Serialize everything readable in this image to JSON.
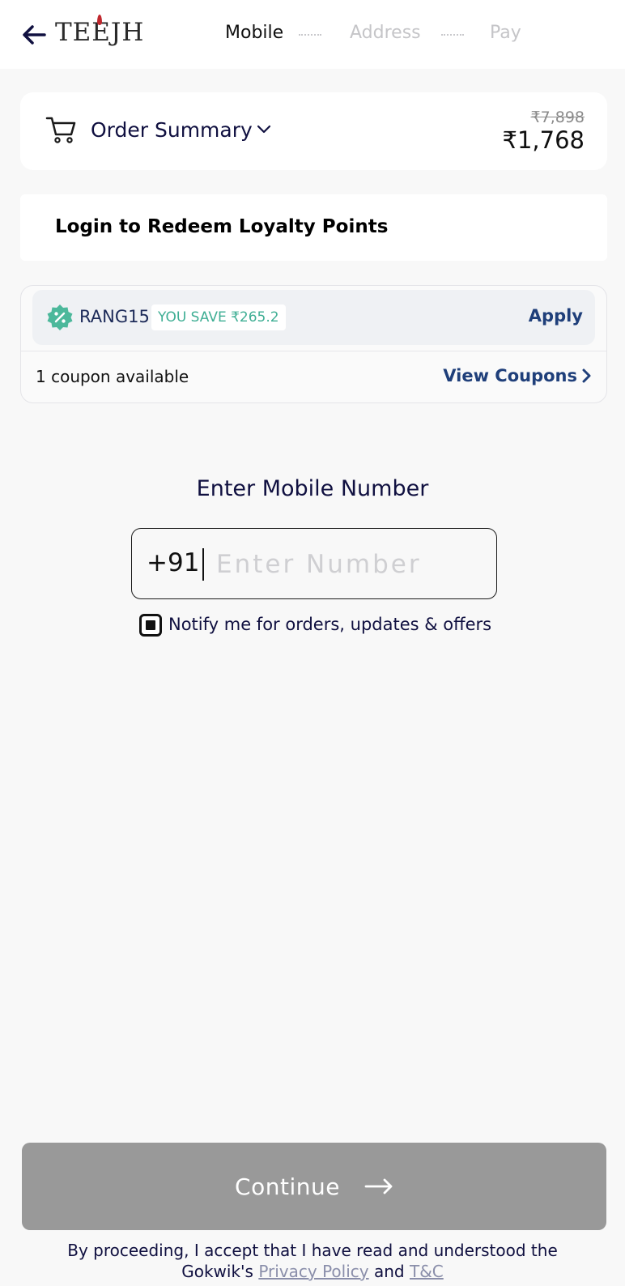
{
  "header": {
    "logo_text": "TEEJH",
    "steps": [
      {
        "label": "Mobile",
        "state": "active"
      },
      {
        "label": "Address",
        "state": "inactive"
      },
      {
        "label": "Pay",
        "state": "inactive"
      }
    ]
  },
  "order_summary": {
    "label": "Order Summary",
    "original_price": "₹7,898",
    "final_price": "₹1,768"
  },
  "loyalty": {
    "label": "Login to Redeem Loyalty Points"
  },
  "coupon": {
    "code": "RANG15",
    "savings": "YOU SAVE ₹265.2",
    "apply_label": "Apply",
    "available_text": "1 coupon available",
    "view_label": "View Coupons"
  },
  "mobile": {
    "title": "Enter Mobile Number",
    "country_code": "+91",
    "placeholder": "Enter Number",
    "value": "",
    "notify_label": "Notify me for orders, updates & offers",
    "notify_checked": true
  },
  "footer": {
    "continue_label": "Continue",
    "disclaimer_prefix": "By proceeding, I accept that I have read and understood the Gokwik's",
    "privacy_label": "Privacy Policy",
    "and_text": "and",
    "tnc_label": "T&C"
  },
  "colors": {
    "accent": "#1f3f7a",
    "coupon_green": "#3fae94",
    "continue_disabled": "#999999",
    "page_bg": "#f8f8f8"
  },
  "icons": [
    "back-arrow-icon",
    "cart-icon",
    "chevron-down-icon",
    "discount-badge-icon",
    "chevron-right-icon",
    "arrow-right-icon"
  ]
}
